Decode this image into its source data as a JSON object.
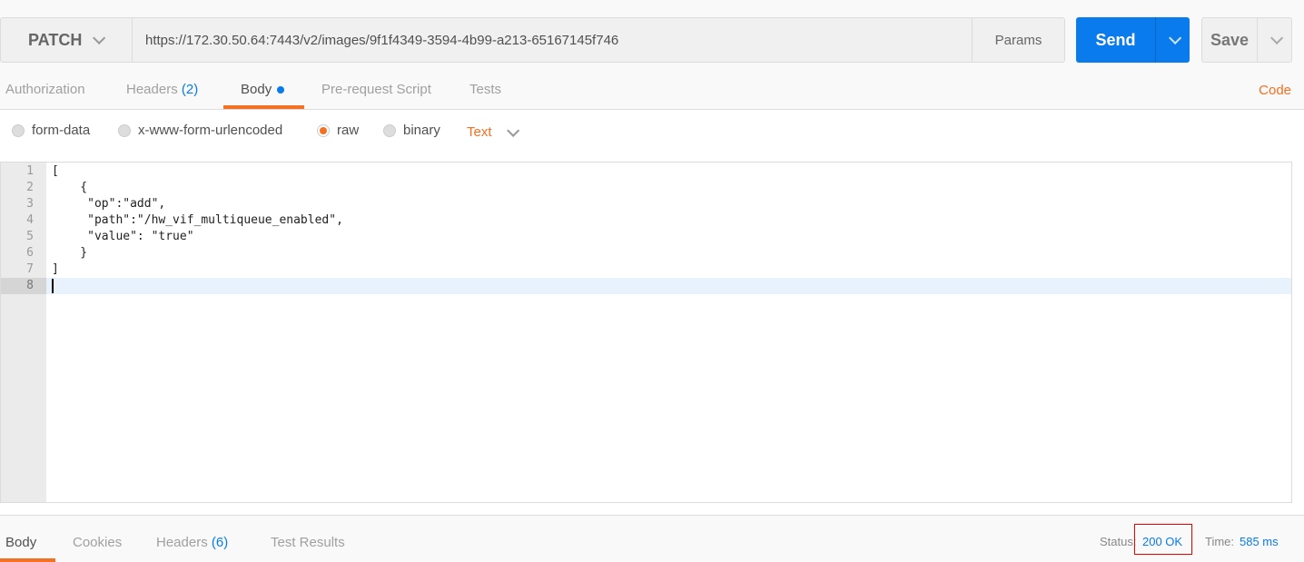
{
  "request": {
    "method": "PATCH",
    "url": "https://172.30.50.64:7443/v2/images/9f1f4349-3594-4b99-a213-65167145f746",
    "params_label": "Params",
    "send_label": "Send",
    "save_label": "Save"
  },
  "tabs": [
    {
      "label": "Authorization"
    },
    {
      "label": "Headers",
      "count": "(2)"
    },
    {
      "label": "Body"
    },
    {
      "label": "Pre-request Script"
    },
    {
      "label": "Tests"
    }
  ],
  "code_label": "Code",
  "body_modes": [
    {
      "label": "form-data"
    },
    {
      "label": "x-www-form-urlencoded"
    },
    {
      "label": "raw",
      "selected": true
    },
    {
      "label": "binary"
    }
  ],
  "raw_type": "Text",
  "editor": {
    "lines": [
      {
        "n": "1",
        "text": "["
      },
      {
        "n": "2",
        "text": "    {"
      },
      {
        "n": "3",
        "text": "     \"op\":\"add\","
      },
      {
        "n": "4",
        "text": "     \"path\":\"/hw_vif_multiqueue_enabled\","
      },
      {
        "n": "5",
        "text": "     \"value\": \"true\""
      },
      {
        "n": "6",
        "text": "    }"
      },
      {
        "n": "7",
        "text": "]"
      },
      {
        "n": "8",
        "text": ""
      }
    ]
  },
  "response": {
    "tabs": [
      {
        "label": "Body"
      },
      {
        "label": "Cookies"
      },
      {
        "label": "Headers",
        "count": "(6)"
      },
      {
        "label": "Test Results"
      }
    ],
    "status_label": "Status:",
    "status": "200 OK",
    "time_label": "Time:",
    "time": "585 ms"
  },
  "colors": {
    "accent": "#f47023",
    "primary": "#097bed",
    "highlight": "#ff0000"
  }
}
